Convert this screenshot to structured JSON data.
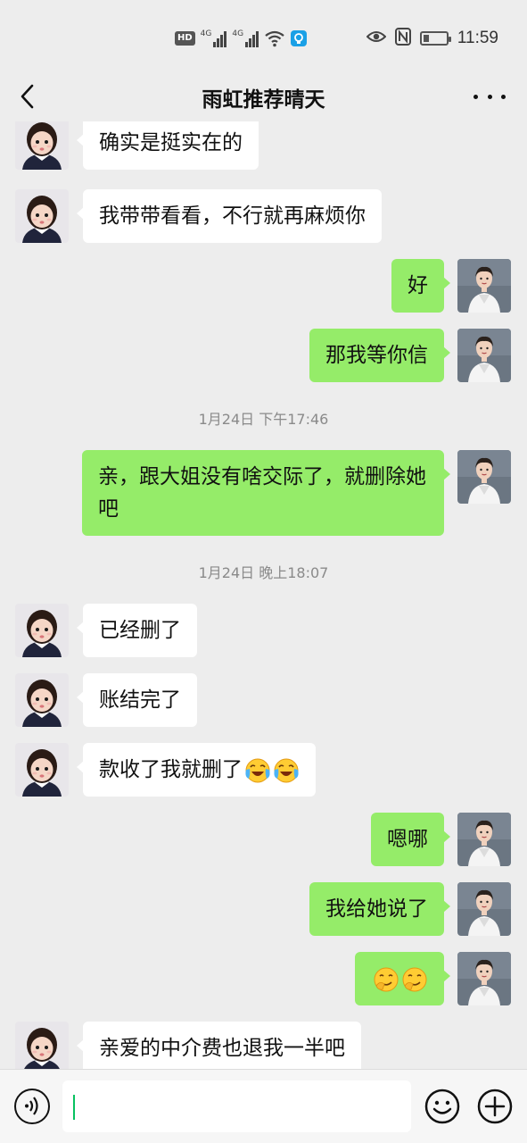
{
  "status_bar": {
    "hd_badge": "HD",
    "net1_label": "4G",
    "net2_label": "4G",
    "time": "11:59",
    "battery_level": 0.25,
    "icons": [
      "hd-icon",
      "signal-icon",
      "signal-icon",
      "wifi-icon",
      "notification-badge-icon",
      "eye-icon",
      "nfc-icon",
      "battery-icon"
    ]
  },
  "header": {
    "title": "雨虹推荐晴天",
    "back_icon": "chevron-left-icon",
    "more_icon": "more-dots-icon"
  },
  "messages": [
    {
      "side": "left",
      "text": "确实是挺实在的"
    },
    {
      "side": "left",
      "text": "我带带看看，不行就再麻烦你"
    },
    {
      "side": "right",
      "text": "好"
    },
    {
      "side": "right",
      "text": "那我等你信"
    },
    {
      "type": "timestamp",
      "text": "1月24日 下午17:46"
    },
    {
      "side": "right",
      "text": "亲，跟大姐没有啥交际了，就删除她吧"
    },
    {
      "type": "timestamp",
      "text": "1月24日 晚上18:07"
    },
    {
      "side": "left",
      "text": "已经删了"
    },
    {
      "side": "left",
      "text": "账结完了"
    },
    {
      "side": "left",
      "text": "款收了我就删了",
      "emojis": [
        "laugh-cry-emoji",
        "laugh-cry-emoji"
      ]
    },
    {
      "side": "right",
      "text": "嗯哪"
    },
    {
      "side": "right",
      "text": "我给她说了"
    },
    {
      "side": "right",
      "text": "",
      "emojis": [
        "smirk-emoji",
        "smirk-emoji"
      ]
    },
    {
      "side": "left",
      "text": "亲爱的中介费也退我一半吧"
    }
  ],
  "input_bar": {
    "voice_icon": "voice-icon",
    "text_value": "",
    "emoji_icon": "emoji-icon",
    "plus_icon": "plus-icon"
  },
  "colors": {
    "sent_bubble": "#95ec69",
    "received_bubble": "#ffffff",
    "background": "#ededed",
    "caret": "#07c160"
  }
}
